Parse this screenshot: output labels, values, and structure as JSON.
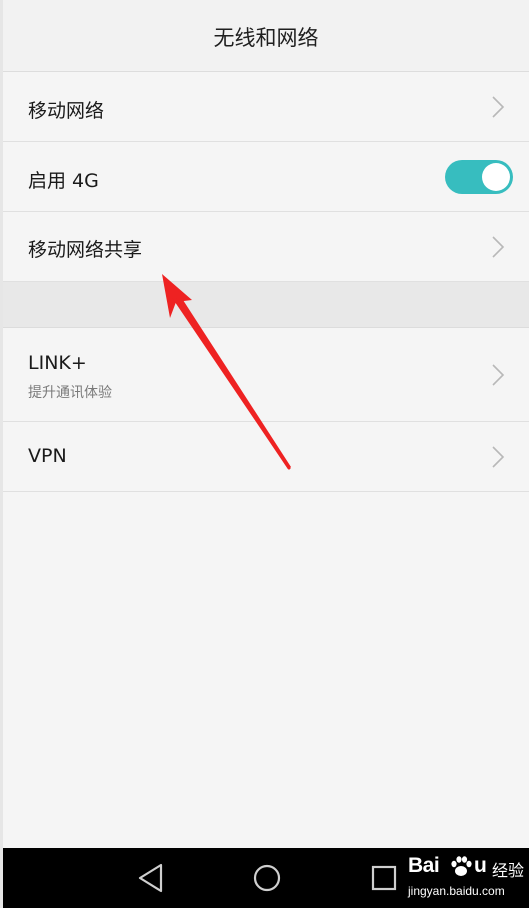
{
  "header": {
    "title": "无线和网络"
  },
  "rows": [
    {
      "label": "移动网络",
      "icon": "chevron-right-icon"
    },
    {
      "label": "启用 4G",
      "toggle": {
        "state": "on",
        "color": "#37bdbf"
      }
    },
    {
      "label": "移动网络共享",
      "icon": "chevron-right-icon"
    },
    {
      "label": "LINK+",
      "sublabel": "提升通讯体验",
      "icon": "chevron-right-icon"
    },
    {
      "label": "VPN",
      "icon": "chevron-right-icon"
    }
  ],
  "annotation": {
    "type": "red-arrow",
    "color": "#ee2222",
    "target": "移动网络共享"
  },
  "navbar": {
    "buttons": [
      {
        "name": "back",
        "icon": "triangle-back-icon"
      },
      {
        "name": "home",
        "icon": "circle-home-icon"
      },
      {
        "name": "recents",
        "icon": "square-recents-icon"
      }
    ]
  },
  "watermark": {
    "brand_left": "Bai",
    "brand_right": "u",
    "brand_cn": "经验",
    "url": "jingyan.baidu.com"
  }
}
